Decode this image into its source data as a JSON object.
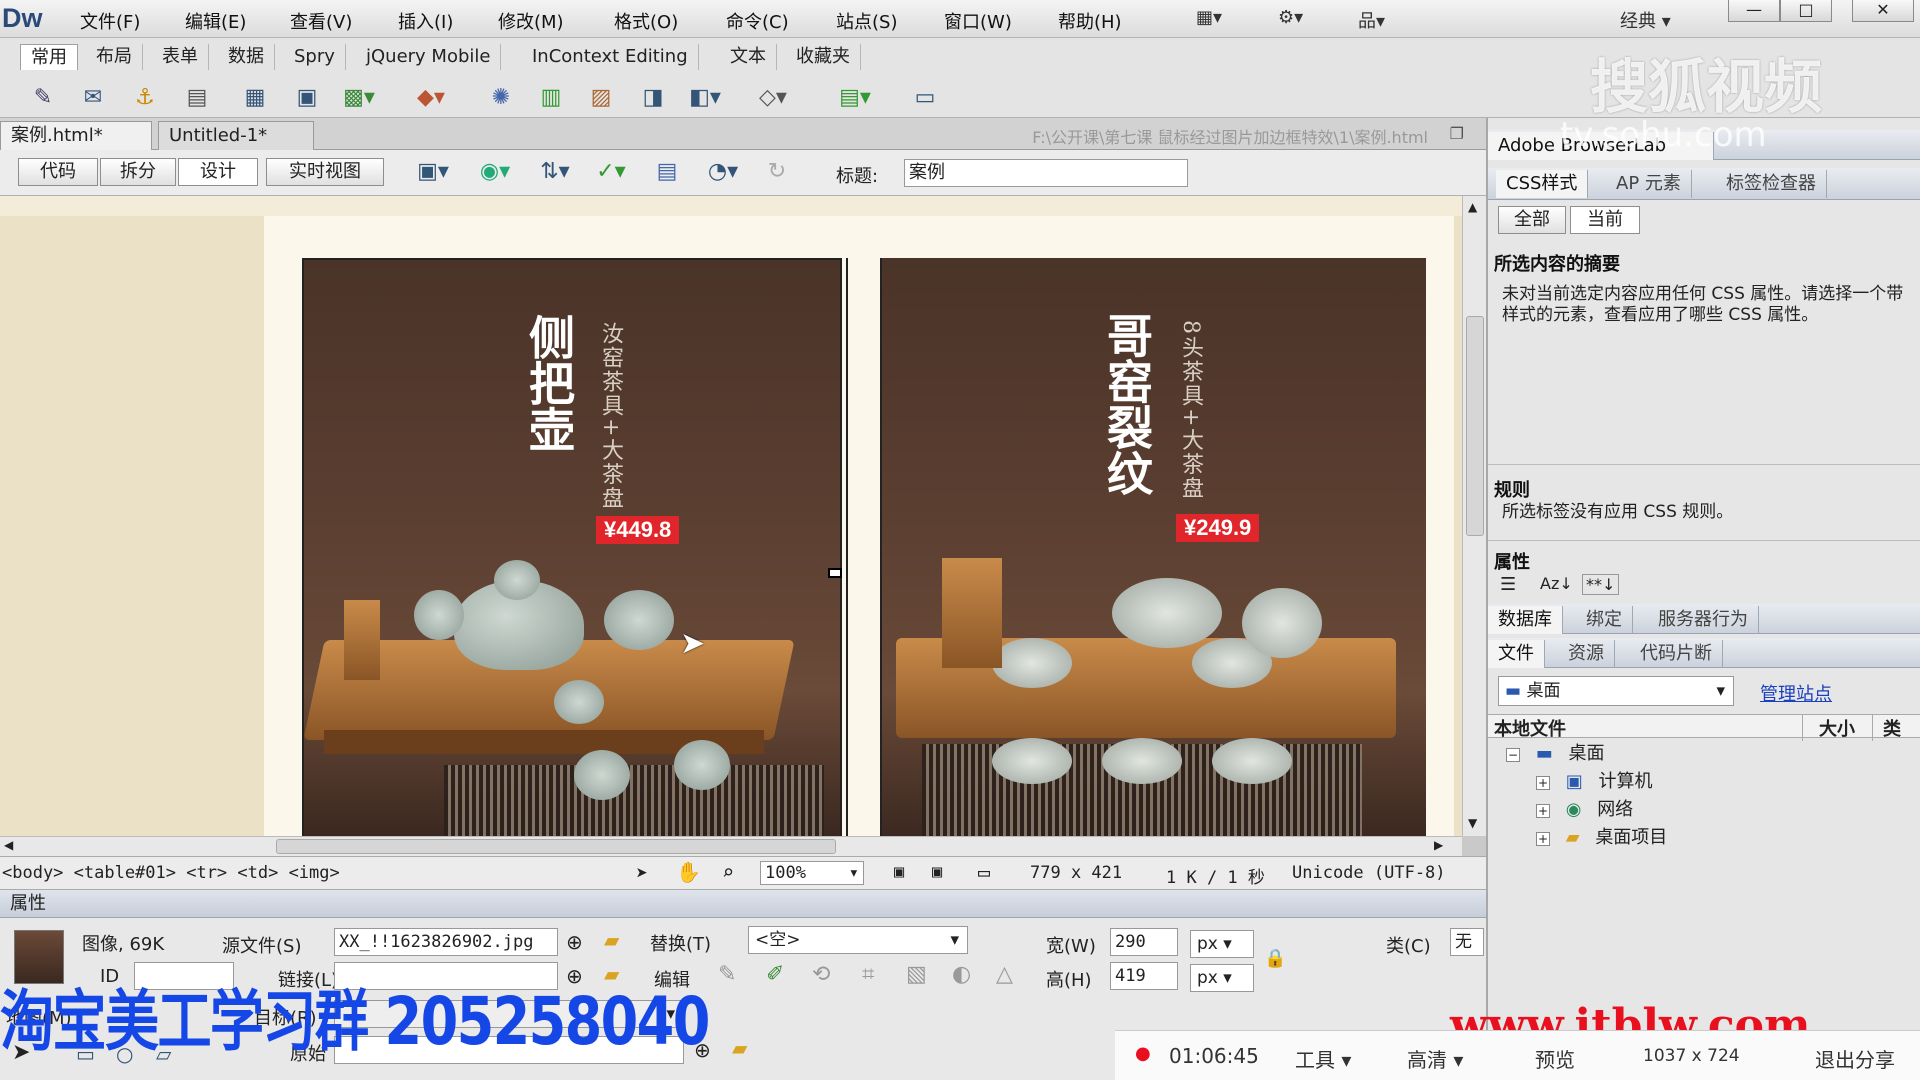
{
  "app": {
    "logo": "Dw",
    "menu": [
      "文件(F)",
      "编辑(E)",
      "查看(V)",
      "插入(I)",
      "修改(M)",
      "格式(O)",
      "命令(C)",
      "站点(S)",
      "窗口(W)",
      "帮助(H)"
    ],
    "workspace": "经典",
    "window_buttons": [
      "—",
      "□",
      "✕"
    ]
  },
  "insert_tabs": [
    "常用",
    "布局",
    "表单",
    "数据",
    "Spry",
    "jQuery Mobile",
    "InContext Editing",
    "文本",
    "收藏夹"
  ],
  "insert_icons": [
    "hyperlink-icon",
    "email-link-icon",
    "anchor-icon",
    "hr-icon",
    "table-icon",
    "div-icon",
    "image-icon",
    "media-icon",
    "widget-icon",
    "date-icon",
    "server-include-icon",
    "comment-icon",
    "head-icon",
    "script-icon",
    "template-icon",
    "tag-chooser-icon"
  ],
  "doc_tabs": [
    {
      "label": "案例.html*",
      "close": "×"
    },
    {
      "label": "Untitled-1*",
      "close": "×"
    }
  ],
  "doc_path": "F:\\公开课\\第七课 鼠标经过图片加边框特效\\1\\案例.html",
  "view_buttons": [
    "代码",
    "拆分",
    "设计",
    "实时视图"
  ],
  "title_label": "标题:",
  "title_value": "案例",
  "products": [
    {
      "title": "侧把壶",
      "subtitle": "汝窑茶具+大茶盘",
      "price": "¥449.8"
    },
    {
      "title": "哥窑裂纹",
      "subtitle": "8头茶具+大茶盘",
      "price": "¥249.9"
    }
  ],
  "status": {
    "tag_path": "<body> <table#01> <tr> <td> <img>",
    "zoom": "100%",
    "dimensions": "779 x 421",
    "size_time": "1 K / 1 秒",
    "encoding": "Unicode (UTF-8)"
  },
  "props": {
    "header": "属性",
    "type": "图像, 69K",
    "id_label": "ID",
    "src_label": "源文件(S)",
    "src_value": "XX_!!1623826902.jpg",
    "link_label": "链接(L)",
    "alt_label": "替换(T)",
    "alt_value": "<空>",
    "edit_label": "编辑",
    "width_label": "宽(W)",
    "width_value": "290",
    "height_label": "高(H)",
    "height_value": "419",
    "unit": "px",
    "class_label": "类(C)",
    "class_value": "无",
    "map_label": "地图(M)",
    "target_label": "目标(R)",
    "original_label": "原始"
  },
  "right_panel": {
    "browserlab": "Adobe BrowserLab",
    "css_tabs": [
      "CSS样式",
      "AP 元素",
      "标签检查器"
    ],
    "mode_buttons": [
      "全部",
      "当前"
    ],
    "summary_title": "所选内容的摘要",
    "summary_text": "未对当前选定内容应用任何 CSS 属性。请选择一个带样式的元素，查看应用了哪些 CSS 属性。",
    "rules_title": "规则",
    "rules_text": "所选标签没有应用 CSS 规则。",
    "props_title": "属性",
    "db_tabs": [
      "数据库",
      "绑定",
      "服务器行为"
    ],
    "file_tabs": [
      "文件",
      "资源",
      "代码片断"
    ],
    "site_select": "桌面",
    "manage_link": "管理站点",
    "file_cols": [
      "本地文件",
      "大小",
      "类"
    ],
    "tree": [
      {
        "label": "桌面",
        "level": 0,
        "icon": "desktop-icon",
        "expander": "−"
      },
      {
        "label": "计算机",
        "level": 1,
        "icon": "computer-icon",
        "expander": "+"
      },
      {
        "label": "网络",
        "level": 1,
        "icon": "network-icon",
        "expander": "+"
      },
      {
        "label": "桌面项目",
        "level": 1,
        "icon": "folder-icon",
        "expander": "+"
      }
    ]
  },
  "watermarks": {
    "sohu": "搜狐视频",
    "sohu_url": "tv.sohu.com",
    "taobao": "淘宝美工学习群 205258040",
    "itblw": "www.itblw.com"
  },
  "player": {
    "time": "01:06:45",
    "tools": "工具",
    "quality": "高清",
    "preview": "预览",
    "resolution": "1037 x 724",
    "exit_share": "退出分享"
  },
  "colors": {
    "price_bg": "#e0262a",
    "link": "#1a3fbf",
    "taobao": "#1547e6",
    "itblw": "#e8101e"
  }
}
